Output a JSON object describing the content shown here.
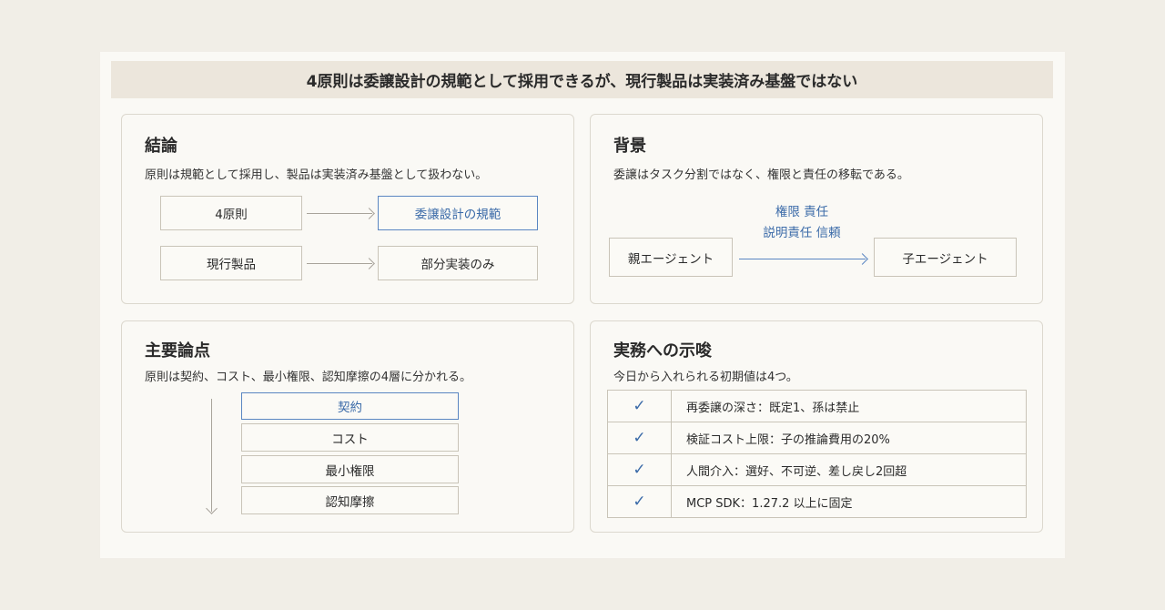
{
  "banner": "4原則は委譲設計の規範として採用できるが、現行製品は実装済み基盤ではない",
  "conclusion": {
    "title": "結論",
    "subtitle": "原則は規範として採用し、製品は実装済み基盤として扱わない。",
    "row1_left": "4原則",
    "row1_right": "委譲設計の規範",
    "row2_left": "現行製品",
    "row2_right": "部分実装のみ"
  },
  "background": {
    "title": "背景",
    "subtitle": "委譲はタスク分割ではなく、権限と責任の移転である。",
    "label_line1": "権限 責任",
    "label_line2": "説明責任 信頼",
    "parent": "親エージェント",
    "child": "子エージェント"
  },
  "issues": {
    "title": "主要論点",
    "subtitle": "原則は契約、コスト、最小権限、認知摩擦の4層に分かれる。",
    "layers": [
      "契約",
      "コスト",
      "最小権限",
      "認知摩擦"
    ]
  },
  "implications": {
    "title": "実務への示唆",
    "subtitle": "今日から入れられる初期値は4つ。",
    "check_icon": "✓",
    "items": [
      "再委譲の深さ：既定1、孫は禁止",
      "検証コスト上限：子の推論費用の20%",
      "人間介入：選好、不可逆、差し戻し2回超",
      "MCP SDK：1.27.2 以上に固定"
    ]
  },
  "colors": {
    "accent": "#3a6aa8",
    "banner_bg": "#ece6dc",
    "page_bg": "#f1eee7"
  }
}
